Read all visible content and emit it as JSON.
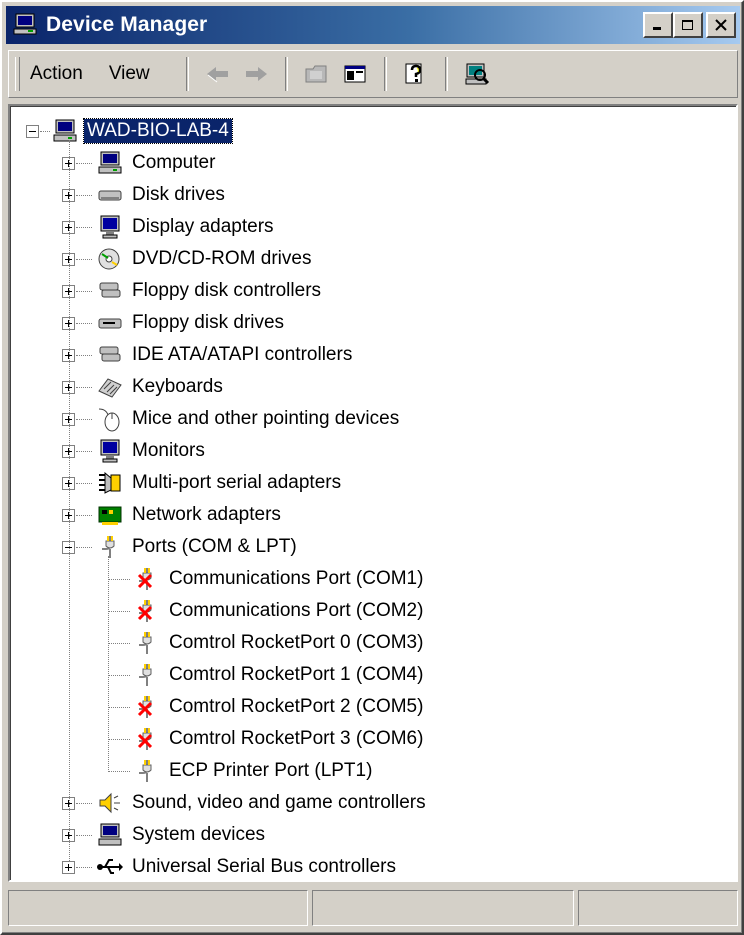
{
  "window": {
    "title": "Device Manager",
    "title_icon": "computer-manage-icon"
  },
  "title_buttons": [
    {
      "name": "minimize",
      "icon": "minimize-icon"
    },
    {
      "name": "maximize",
      "icon": "maximize-icon"
    },
    {
      "name": "close",
      "icon": "close-icon"
    }
  ],
  "menu": {
    "action": "Action",
    "view": "View"
  },
  "toolbar_icons": [
    "back-arrow-icon",
    "forward-arrow-icon",
    "folder-up-icon",
    "show-hide-tree-icon",
    "help-icon",
    "scan-hardware-icon"
  ],
  "tree": {
    "root": {
      "label": "WAD-BIO-LAB-4",
      "expanded": true
    },
    "categories": [
      {
        "label": "Computer",
        "icon": "computer-icon",
        "expanded": false
      },
      {
        "label": "Disk drives",
        "icon": "disk-drive-icon",
        "expanded": false
      },
      {
        "label": "Display adapters",
        "icon": "display-adapter-icon",
        "expanded": false
      },
      {
        "label": "DVD/CD-ROM drives",
        "icon": "cdrom-icon",
        "expanded": false
      },
      {
        "label": "Floppy disk controllers",
        "icon": "floppy-controller-icon",
        "expanded": false
      },
      {
        "label": "Floppy disk drives",
        "icon": "floppy-drive-icon",
        "expanded": false
      },
      {
        "label": "IDE ATA/ATAPI controllers",
        "icon": "ide-controller-icon",
        "expanded": false
      },
      {
        "label": "Keyboards",
        "icon": "keyboard-icon",
        "expanded": false
      },
      {
        "label": "Mice and other pointing devices",
        "icon": "mouse-icon",
        "expanded": false
      },
      {
        "label": "Monitors",
        "icon": "monitor-icon",
        "expanded": false
      },
      {
        "label": "Multi-port serial adapters",
        "icon": "multiport-serial-icon",
        "expanded": false
      },
      {
        "label": "Network adapters",
        "icon": "network-adapter-icon",
        "expanded": false
      },
      {
        "label": "Ports (COM & LPT)",
        "icon": "port-icon",
        "expanded": true,
        "children": [
          {
            "label": "Communications Port (COM1)",
            "disabled": true
          },
          {
            "label": "Communications Port (COM2)",
            "disabled": true
          },
          {
            "label": "Comtrol RocketPort 0 (COM3)",
            "disabled": false
          },
          {
            "label": "Comtrol RocketPort 1 (COM4)",
            "disabled": false
          },
          {
            "label": "Comtrol RocketPort 2 (COM5)",
            "disabled": true
          },
          {
            "label": "Comtrol RocketPort 3 (COM6)",
            "disabled": true
          },
          {
            "label": "ECP Printer Port (LPT1)",
            "disabled": false
          }
        ]
      },
      {
        "label": "Sound, video and game controllers",
        "icon": "sound-icon",
        "expanded": false
      },
      {
        "label": "System devices",
        "icon": "system-device-icon",
        "expanded": false
      },
      {
        "label": "Universal Serial Bus controllers",
        "icon": "usb-icon",
        "expanded": false
      }
    ]
  },
  "colors": {
    "title_start": "#0a246a",
    "title_end": "#a6caf0",
    "selection": "#0a246a",
    "face": "#d4d0c8"
  }
}
